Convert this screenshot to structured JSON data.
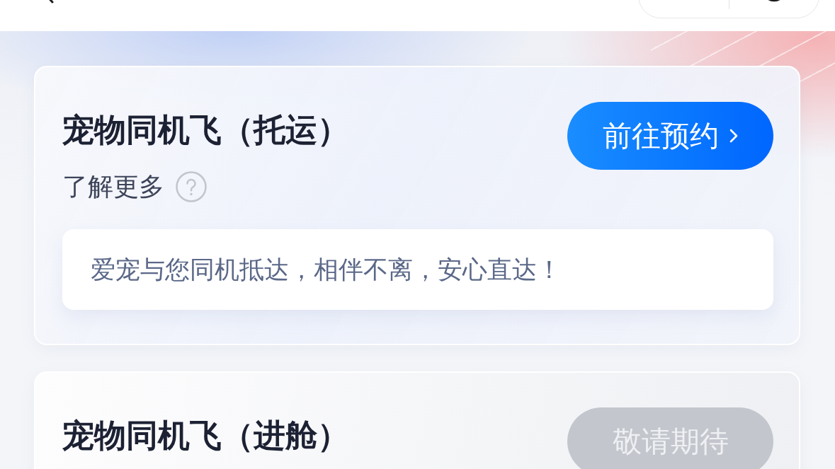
{
  "services": [
    {
      "title": "宠物同机飞（托运）",
      "learn_more": "了解更多",
      "button": {
        "label": "前往预约",
        "disabled": false
      },
      "description": "爱宠与您同机抵达，相伴不离，安心直达！"
    },
    {
      "title": "宠物同机飞（进舱）",
      "button": {
        "label": "敬请期待",
        "disabled": true
      }
    }
  ]
}
